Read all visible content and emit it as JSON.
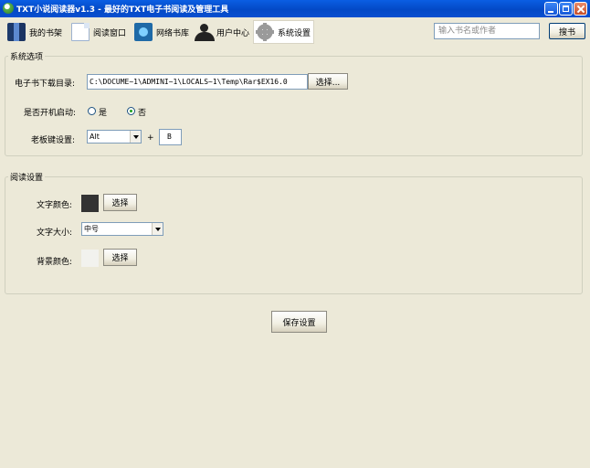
{
  "window": {
    "title": "TXT小说阅读器v1.3 - 最好的TXT电子书阅读及管理工具",
    "minimize_icon": "minimize-icon",
    "maximize_icon": "maximize-icon",
    "close_icon": "close-icon"
  },
  "toolbar": {
    "items": [
      {
        "label": "我的书架",
        "icon": "bookshelf-icon"
      },
      {
        "label": "阅读窗口",
        "icon": "document-icon"
      },
      {
        "label": "网络书库",
        "icon": "web-library-icon"
      },
      {
        "label": "用户中心",
        "icon": "user-icon"
      },
      {
        "label": "系统设置",
        "icon": "gear-icon",
        "active": true
      }
    ],
    "search_placeholder": "输入书名或作者",
    "search_value": "",
    "search_button": "搜书"
  },
  "system": {
    "title": "系统选项",
    "download_label": "电子书下载目录:",
    "download_path": "C:\\DOCUME~1\\ADMINI~1\\LOCALS~1\\Temp\\Rar$EX16.0",
    "choose_button": "选择...",
    "autostart_label": "是否开机启动:",
    "autostart_yes": "是",
    "autostart_no": "否",
    "autostart_selected": "否",
    "bosskey_label": "老板键设置:",
    "bosskey_modifier": "Alt",
    "plus": "+",
    "bosskey_key": "B"
  },
  "reading": {
    "title": "阅读设置",
    "text_color_label": "文字颜色:",
    "text_color": "#333333",
    "text_color_button": "选择",
    "text_size_label": "文字大小:",
    "text_size_value": "中号",
    "bg_color_label": "背景颜色:",
    "bg_color": "#f2f2ee",
    "bg_color_button": "选择"
  },
  "save_button": "保存设置"
}
